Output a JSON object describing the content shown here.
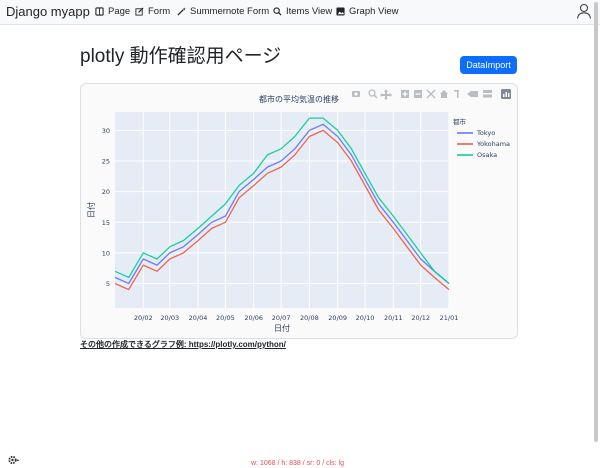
{
  "navbar": {
    "brand": "Django myapp",
    "items": [
      {
        "label": "Page",
        "icon": "book-icon"
      },
      {
        "label": "Form",
        "icon": "edit-icon"
      },
      {
        "label": "Summernote Form",
        "icon": "magic-wand-icon"
      },
      {
        "label": "Items View",
        "icon": "search-icon"
      },
      {
        "label": "Graph View",
        "icon": "image-icon"
      }
    ]
  },
  "page": {
    "heading": "plotly 動作確認用ページ",
    "import_button": "DataImport",
    "link_text": "その他の作成できるグラフ例: https://plotly.com/python/",
    "debug_text": "w: 1068 / h: 838 / sr: 0 / cls: lg"
  },
  "colors": {
    "accent": "#0d6efd",
    "tokyo": "#636efa",
    "yokohama": "#ef553b",
    "osaka": "#00cc96"
  },
  "chart_data": {
    "type": "line",
    "title": "都市の平均気温の推移",
    "xlabel": "日付",
    "ylabel": "日付",
    "legend_title": "都市",
    "legend_position": "top-right",
    "x_ticks": [
      "20/02",
      "20/03",
      "20/04",
      "20/05",
      "20/06",
      "20/07",
      "20/08",
      "20/09",
      "20/10",
      "20/11",
      "20/12",
      "21/01"
    ],
    "y_ticks": [
      5,
      10,
      15,
      20,
      25,
      30
    ],
    "x_range": [
      "2020-01-01",
      "2021-01-01"
    ],
    "ylim": [
      1,
      33
    ],
    "grid": true,
    "x": [
      "2020-01-01",
      "2020-01-16",
      "2020-02-01",
      "2020-02-16",
      "2020-03-01",
      "2020-03-16",
      "2020-04-01",
      "2020-04-16",
      "2020-05-01",
      "2020-05-16",
      "2020-06-01",
      "2020-06-16",
      "2020-07-01",
      "2020-07-16",
      "2020-08-01",
      "2020-08-16",
      "2020-09-01",
      "2020-09-16",
      "2020-10-01",
      "2020-10-16",
      "2020-11-01",
      "2020-11-16",
      "2020-12-01",
      "2020-12-16",
      "2021-01-01"
    ],
    "series": [
      {
        "name": "Tokyo",
        "values": [
          6,
          5,
          9,
          8,
          10,
          11,
          13,
          15,
          16,
          20,
          22,
          24,
          25,
          27,
          30,
          31,
          29,
          26,
          22,
          18,
          15,
          12,
          9,
          7,
          5
        ]
      },
      {
        "name": "Yokohama",
        "values": [
          5,
          4,
          8,
          7,
          9,
          10,
          12,
          14,
          15,
          19,
          21,
          23,
          24,
          26,
          29,
          30,
          28,
          25,
          21,
          17,
          14,
          11,
          8,
          6,
          4
        ]
      },
      {
        "name": "Osaka",
        "values": [
          7,
          6,
          10,
          9,
          11,
          12,
          14,
          16,
          18,
          21,
          23,
          26,
          27,
          29,
          32,
          32,
          30,
          27,
          23,
          19,
          16,
          13,
          10,
          7,
          5
        ]
      }
    ]
  }
}
